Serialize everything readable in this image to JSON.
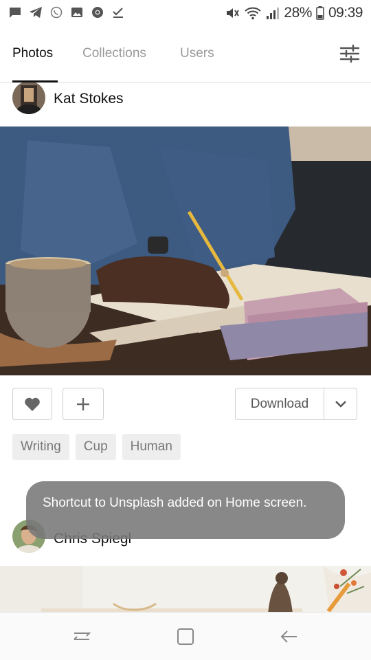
{
  "status_bar": {
    "battery": "28%",
    "time": "09:39",
    "left_icons": [
      "message-icon",
      "telegram-icon",
      "whatsapp-icon",
      "gallery-icon",
      "chrome-icon",
      "download-done-icon"
    ],
    "right_icons": [
      "mute-icon",
      "wifi-icon",
      "signal-icon",
      "battery-icon"
    ]
  },
  "tabs": [
    {
      "label": "Photos",
      "active": true
    },
    {
      "label": "Collections",
      "active": false
    },
    {
      "label": "Users",
      "active": false
    }
  ],
  "feed": {
    "post1": {
      "author": "Kat Stokes",
      "tags": [
        "Writing",
        "Cup",
        "Human"
      ],
      "download_label": "Download"
    },
    "post2": {
      "author": "Chris Spiegl"
    }
  },
  "toast": {
    "message": "Shortcut to Unsplash added on Home screen."
  },
  "colors": {
    "accent": "#111111",
    "inactive_tab": "#999999",
    "tag_bg": "#eeeeee",
    "toast_bg": "#787878"
  }
}
